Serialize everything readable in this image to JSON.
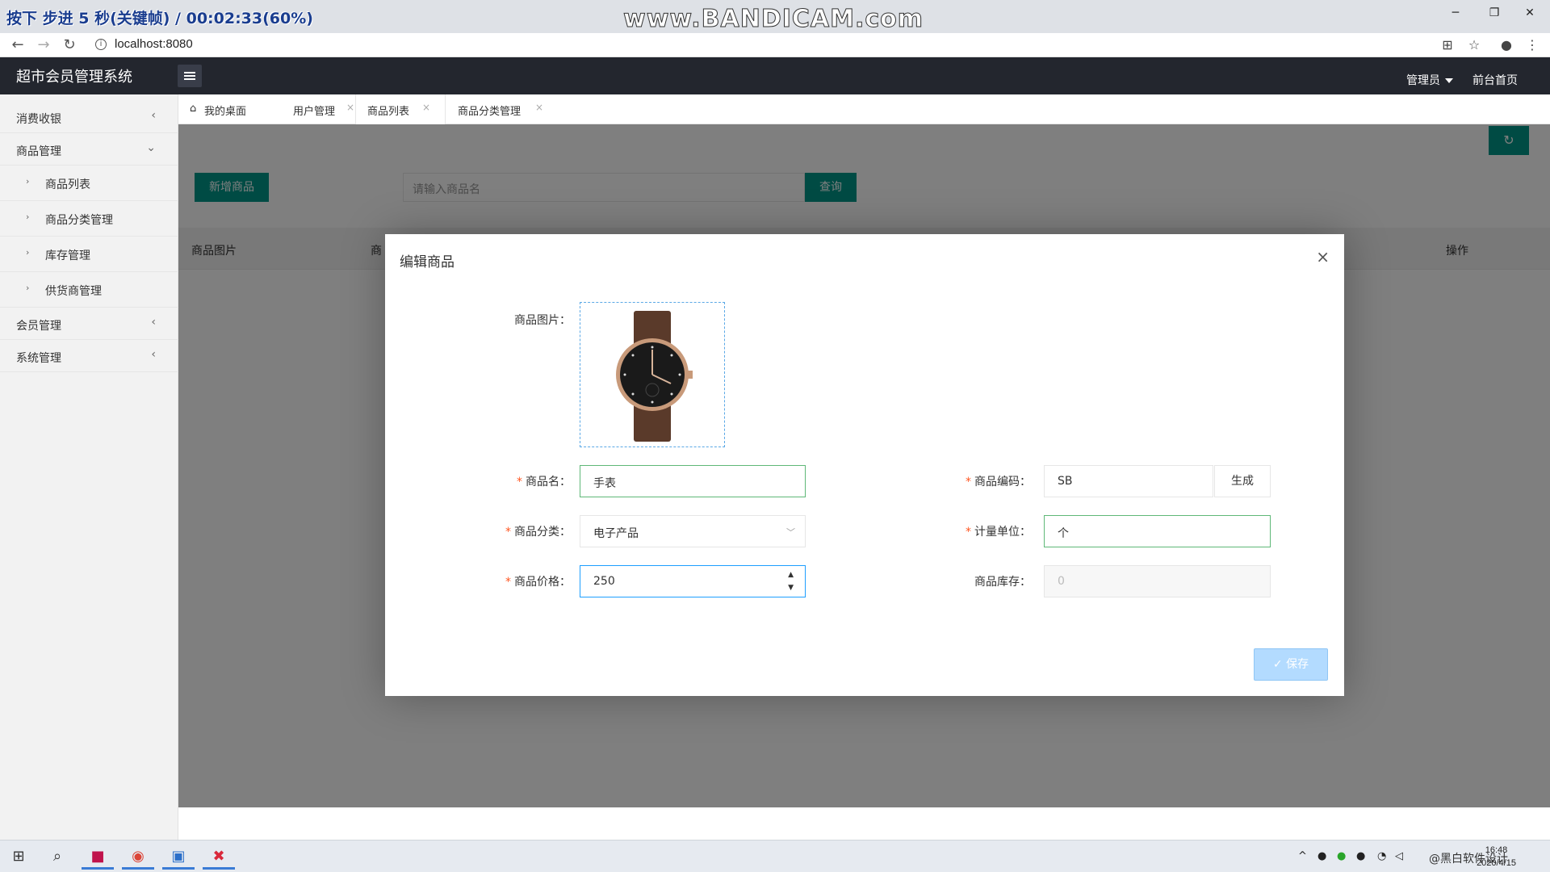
{
  "recording": {
    "overlay_left": "按下 步进 5 秒(关键帧) / 00:02:33(60%)",
    "overlay_center": "www.BANDICAM.com"
  },
  "browser": {
    "url": "localhost:8080",
    "window_controls": {
      "minimize": "─",
      "restore": "❐",
      "close": "✕"
    }
  },
  "app": {
    "title": "超市会员管理系统",
    "user_menu": "管理员",
    "frontend_link": "前台首页"
  },
  "sidebar": {
    "items": [
      {
        "label": "消费收银",
        "arrow": "‹"
      },
      {
        "label": "商品管理",
        "arrow": "⌄"
      },
      {
        "label": "会员管理",
        "arrow": "‹"
      },
      {
        "label": "系统管理",
        "arrow": "‹"
      }
    ],
    "sub_items": [
      {
        "label": "商品列表"
      },
      {
        "label": "商品分类管理"
      },
      {
        "label": "库存管理"
      },
      {
        "label": "供货商管理"
      }
    ]
  },
  "tabs": [
    {
      "label": "我的桌面",
      "closable": false
    },
    {
      "label": "用户管理",
      "closable": true
    },
    {
      "label": "商品列表",
      "closable": true,
      "active": true
    },
    {
      "label": "商品分类管理",
      "closable": true
    }
  ],
  "toolbar": {
    "add_label": "新增商品",
    "search_placeholder": "请输入商品名",
    "query_label": "查询",
    "refresh_icon": "↻"
  },
  "table": {
    "columns": [
      "商品图片",
      "商",
      "操作"
    ]
  },
  "modal": {
    "title": "编辑商品",
    "close_icon": "×",
    "fields": {
      "image_label": "商品图片：",
      "name_label": "商品名：",
      "name_value": "手表",
      "code_label": "商品编码：",
      "code_value": "SB",
      "generate_label": "生成",
      "category_label": "商品分类：",
      "category_value": "电子产品",
      "unit_label": "计量单位：",
      "unit_value": "个",
      "price_label": "商品价格：",
      "price_value": "250",
      "stock_label": "商品库存：",
      "stock_value": "0"
    },
    "save_label": "✓ 保存"
  },
  "taskbar": {
    "time": "16:48",
    "date": "2020/4/15",
    "tray_text": "@黑白软件设计"
  },
  "colors": {
    "accent": "#009688",
    "header_bg": "#23262e",
    "required": "#ff5722",
    "save_btn": "#b3dbff"
  }
}
